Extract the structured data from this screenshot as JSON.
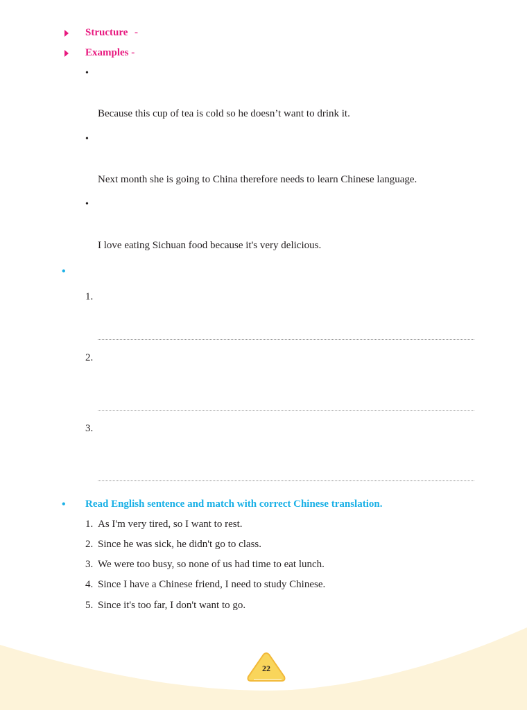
{
  "structure": {
    "label": "Structure",
    "dash": "-",
    "part1": "",
    "part2": ""
  },
  "examples": {
    "label": "Examples -",
    "items": [
      {
        "chinese": "",
        "pinyin": "",
        "english": "Because this cup of tea is cold so he doesn’t want to drink it."
      },
      {
        "chinese": "",
        "pinyin": "",
        "english": "Next month she is going to China therefore needs to learn Chinese language."
      },
      {
        "chinese": "",
        "pinyin": "",
        "english": "I love eating Sichuan food because it's very delicious."
      }
    ]
  },
  "make_sentences": {
    "heading": "",
    "items": [
      {
        "num": "1.",
        "pinyin": "",
        "chinese": ""
      },
      {
        "num": "2.",
        "pinyin": "",
        "chinese": ""
      },
      {
        "num": "3.",
        "pinyin": "",
        "chinese": ""
      }
    ]
  },
  "match": {
    "heading": "Read English sentence and match with correct Chinese translation.",
    "items": [
      {
        "num": "1.",
        "text": "As I'm very tired, so I want to rest."
      },
      {
        "num": "2.",
        "text": "Since he was sick, he didn't go to class."
      },
      {
        "num": "3.",
        "text": "We were too busy, so none of us had time to eat lunch."
      },
      {
        "num": "4.",
        "text": "Since I have a Chinese friend, I need to study Chinese."
      },
      {
        "num": "5.",
        "text": "Since it's too far, I don't want to go."
      }
    ]
  },
  "page_number": "22",
  "colors": {
    "accent_magenta": "#e8197f",
    "accent_cyan": "#1ab0e6",
    "wave": "#fdf3d9",
    "page_badge": "#f9d55b"
  }
}
